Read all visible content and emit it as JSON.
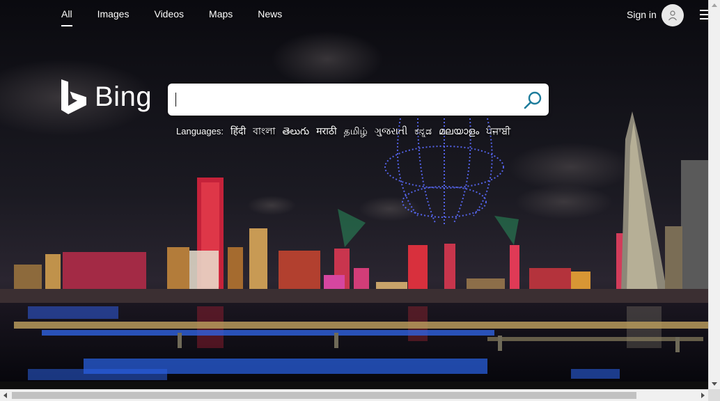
{
  "nav": {
    "tabs": [
      {
        "label": "All",
        "active": true
      },
      {
        "label": "Images",
        "active": false
      },
      {
        "label": "Videos",
        "active": false
      },
      {
        "label": "Maps",
        "active": false
      },
      {
        "label": "News",
        "active": false
      }
    ],
    "signin_label": "Sign in"
  },
  "logo": {
    "text": "Bing"
  },
  "search": {
    "value": "",
    "placeholder": ""
  },
  "languages": {
    "label": "Languages:",
    "links": [
      "हिंदी",
      "বাংলা",
      "తెలుగు",
      "मराठी",
      "தமிழ்",
      "ગુજરાતી",
      "ಕನ್ನಡ",
      "മലയാളം",
      "ਪੰਜਾਬੀ"
    ]
  },
  "colors": {
    "bing_blue": "#174ae4",
    "search_icon": "#1d7c9b"
  },
  "icons": {
    "search": "search-icon",
    "avatar": "user-avatar-icon",
    "menu": "hamburger-menu-icon",
    "logo": "bing-logo-icon"
  }
}
